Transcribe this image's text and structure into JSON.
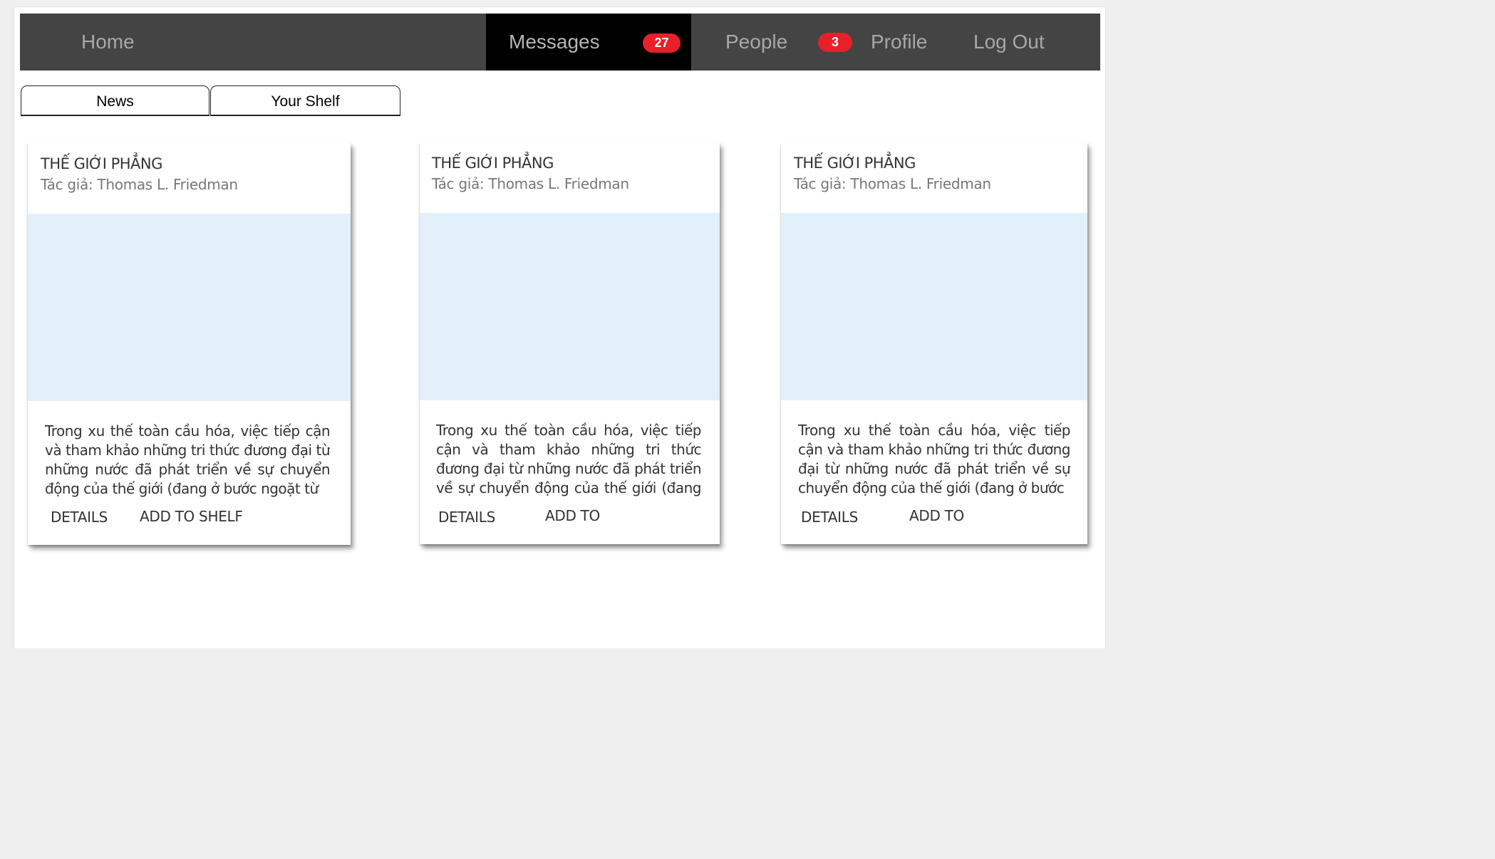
{
  "nav": {
    "home": "Home",
    "messages": "Messages",
    "messages_badge": "27",
    "people": "People",
    "people_badge": "3",
    "profile": "Profile",
    "logout": "Log Out"
  },
  "tabs": [
    {
      "label": "News"
    },
    {
      "label": "Your Shelf"
    }
  ],
  "cards": [
    {
      "title": "THẾ GIỚI PHẲNG",
      "author": "Tác giả: Thomas L. Friedman",
      "description": "Trong xu thế toàn cầu hóa, việc tiếp cận và tham khảo những tri thức đương đại từ những nước đã phát triển về sự chuyển động của thế giới (đang ở bước ngoặt từ",
      "details_label": "DETAILS",
      "add_label": "ADD TO SHELF"
    },
    {
      "title": "THẾ GIỚI PHẲNG",
      "author": "Tác giả: Thomas L. Friedman",
      "description": "Trong xu thế toàn cầu hóa, việc tiếp cận và tham khảo những tri thức đương đại từ những nước đã phát triển về sự chuyển động của thế giới (đang ở bước",
      "details_label": "DETAILS",
      "add_label": "ADD TO"
    },
    {
      "title": "THẾ GIỚI PHẲNG",
      "author": "Tác giả: Thomas L. Friedman",
      "description": "Trong xu thế toàn cầu hóa, việc tiếp cận và tham khảo những tri thức đương đại từ những nước đã phát triển về sự chuyển động của thế giới (đang ở bước",
      "details_label": "DETAILS",
      "add_label": "ADD TO"
    }
  ],
  "colors": {
    "nav_bg": "#444444",
    "nav_active_bg": "#000000",
    "nav_text": "#a8a8a8",
    "badge_bg": "#e8202a",
    "media_placeholder": "#e2f0fc"
  }
}
